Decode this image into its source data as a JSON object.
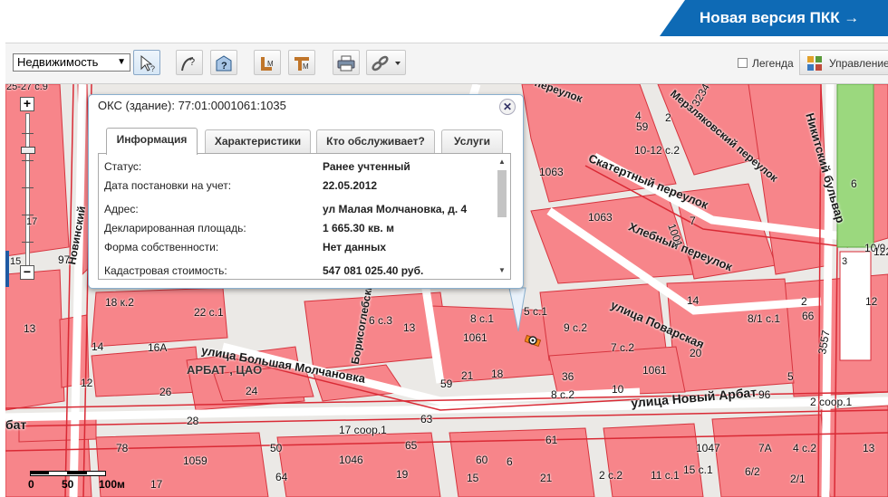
{
  "banner": {
    "label": "Новая версия ПКК →",
    "color": "#0e6ab5"
  },
  "toolbar": {
    "layer_select": "Недвижимость",
    "legend_label": "Легенда",
    "manage_label": "Управление"
  },
  "popup": {
    "title": "ОКС (здание): 77:01:0001061:1035",
    "tabs": [
      {
        "label": "Информация",
        "active": true
      },
      {
        "label": "Характеристики",
        "active": false
      },
      {
        "label": "Кто обслуживает?",
        "active": false
      },
      {
        "label": "Услуги",
        "active": false
      }
    ],
    "rows": [
      {
        "key": "Статус:",
        "value": "Ранее учтенный"
      },
      {
        "key": "Дата постановки на учет:",
        "value": "22.05.2012"
      },
      {
        "key": "Адрес:",
        "value": "ул Малая Молчановка, д. 4"
      },
      {
        "key": "Декларированная площадь:",
        "value": "1 665.30 кв. м"
      },
      {
        "key": "Форма собственности:",
        "value": "Нет данных"
      },
      {
        "key": "Кадастровая стоимость:",
        "value": "547 081 025.40 руб."
      }
    ]
  },
  "map": {
    "zoom_top": "25-27 с.9",
    "zoom_left": "15",
    "zoom_mid": "17",
    "scale": {
      "l0": "0",
      "l1": "50",
      "l2": "100м"
    },
    "district": "АРБАТ , ЦАО",
    "streets": {
      "novy_arbat": "улица Новый Арбат",
      "bolshaya_molchanovka": "улица Большая Молчановка",
      "povarskaya": "улица Поварская",
      "nikitsky": "Никитский бульвар",
      "skaterny": "Скатертный переулок",
      "khlebny": "Хлебный переулок",
      "merzlyakovsky": "Мерзляковский переулок",
      "borisoglebsky": "Борисоглебский",
      "novinsky": "Новинский",
      "arbat_left": "бат",
      "pereulok_top": "переулок"
    },
    "labels": [
      "4",
      "3234",
      "10-12 с.2",
      "2",
      "1063",
      "6",
      "7",
      "1063",
      "1001",
      "10/9",
      "14",
      "12",
      "2",
      "5 с.1",
      "9 с.2",
      "7 с.2",
      "8/1 с.1",
      "66",
      "3557",
      "20",
      "1061",
      "8 с.1",
      "1061",
      "6 с.3",
      "13",
      "22 с.1",
      "18 к.2",
      "18",
      "21",
      "59",
      "36",
      "10",
      "8 с.2",
      "5",
      "96",
      "2 соор.1",
      "17 соор.1",
      "97",
      "13",
      "14",
      "16А",
      "12",
      "26",
      "24",
      "28",
      "78",
      "50",
      "1059",
      "64",
      "65",
      "61",
      "63",
      "15",
      "60",
      "1046",
      "19",
      "17",
      "21",
      "2 с.2",
      "11 с.1",
      "15 с.1",
      "6/2",
      "4 с.2",
      "2/1",
      "1047",
      "7А",
      "13",
      "3",
      "122",
      "6",
      "59",
      "4"
    ],
    "marker_color": "#e8600c",
    "building_color": "#f7858a"
  }
}
